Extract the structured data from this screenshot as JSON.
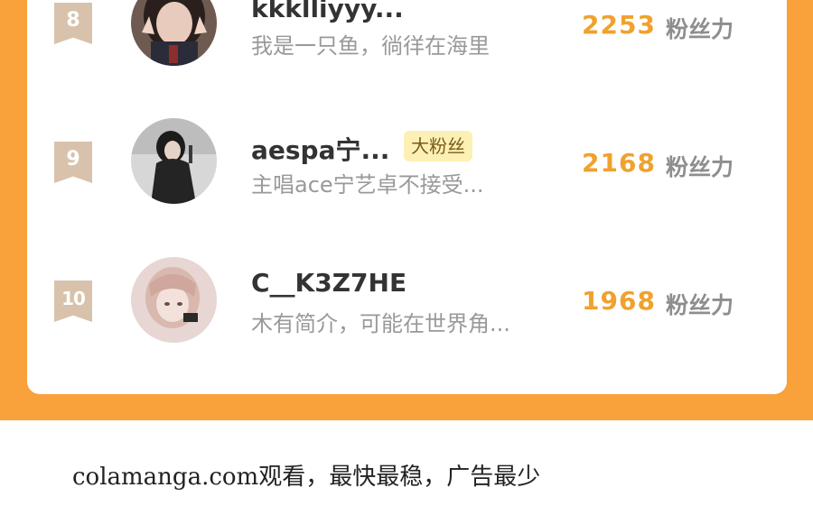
{
  "ranking": {
    "rows": [
      {
        "rank": "8",
        "name": "kkklliyyy...",
        "bio": "我是一只鱼，徜徉在海里",
        "score": "2253",
        "unit": "粉丝力",
        "badge": ""
      },
      {
        "rank": "9",
        "name": "aespa宁...",
        "bio": "主唱ace宁艺卓不接受...",
        "score": "2168",
        "unit": "粉丝力",
        "badge": "大粉丝"
      },
      {
        "rank": "10",
        "name": "C__K3Z7HE",
        "bio": "木有简介，可能在世界角...",
        "score": "1968",
        "unit": "粉丝力",
        "badge": ""
      }
    ]
  },
  "colors": {
    "panel": "#f9a13a",
    "score": "#efa22d",
    "rank_badge": "#d8c2ac",
    "fan_badge": "#fdf0b4"
  },
  "footer": {
    "watermark": "colamanga.com观看，最快最稳，广告最少"
  }
}
